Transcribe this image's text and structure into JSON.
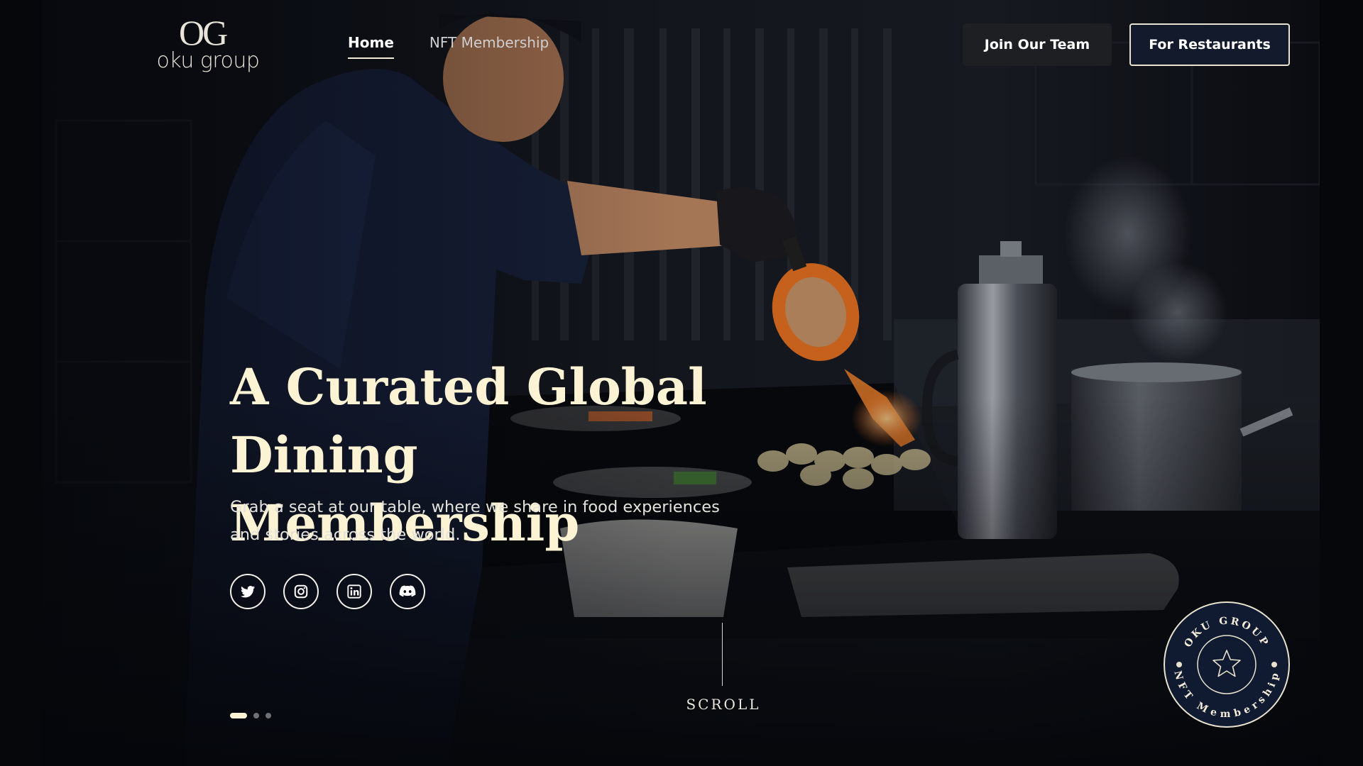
{
  "brand": {
    "monogram": "OG",
    "wordmark": "oku group"
  },
  "nav": {
    "items": [
      {
        "label": "Home",
        "active": true
      },
      {
        "label": "NFT Membership",
        "active": false
      }
    ]
  },
  "header_buttons": {
    "join": "Join Our Team",
    "restaurants": "For Restaurants"
  },
  "hero": {
    "headline_line1": "A Curated Global",
    "headline_line2": "Dining Membership",
    "subtext_line1": "Grab a seat at our table, where we share in food experiences",
    "subtext_line2": "and stories across the world."
  },
  "socials": [
    "twitter-icon",
    "instagram-icon",
    "linkedin-icon",
    "discord-icon"
  ],
  "carousel": {
    "slides": 3,
    "active_index": 0
  },
  "scroll": {
    "label": "SCROLL"
  },
  "badge": {
    "top_text": "OKU GROUP",
    "bottom_text": "NFT Membership"
  },
  "colors": {
    "headline": "#fbf3d3",
    "accent_border": "#e8e2cf",
    "primary_button": "#121a2c",
    "secondary_button": "#1e1f22",
    "badge_bg": "#101a30"
  }
}
